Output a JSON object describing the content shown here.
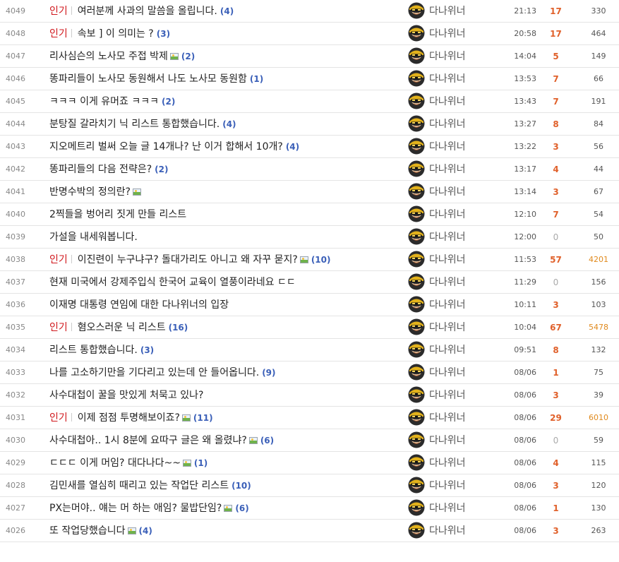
{
  "hot_label": "인기",
  "writer_name": "다나위너",
  "rows": [
    {
      "num": "4049",
      "hot": true,
      "title": "여러분께 사과의 말씀을 올립니다.",
      "img": false,
      "comments": "(4)",
      "date": "21:13",
      "rec": "17",
      "views": "330"
    },
    {
      "num": "4048",
      "hot": true,
      "title": "속보 ] 이 의미는 ?",
      "img": false,
      "comments": "(3)",
      "date": "20:58",
      "rec": "17",
      "views": "464"
    },
    {
      "num": "4047",
      "hot": false,
      "title": "리사심슨의 노사모 주접 박제",
      "img": true,
      "comments": "(2)",
      "date": "14:04",
      "rec": "5",
      "views": "149"
    },
    {
      "num": "4046",
      "hot": false,
      "title": "똥파리들이 노사모 동원해서 나도 노사모 동원함",
      "img": false,
      "comments": "(1)",
      "date": "13:53",
      "rec": "7",
      "views": "66"
    },
    {
      "num": "4045",
      "hot": false,
      "title": "ㅋㅋㅋ 이게 유머죠 ㅋㅋㅋ",
      "img": false,
      "comments": "(2)",
      "date": "13:43",
      "rec": "7",
      "views": "191"
    },
    {
      "num": "4044",
      "hot": false,
      "title": "분탕질 갈라치기 닉 리스트 통합했습니다.",
      "img": false,
      "comments": "(4)",
      "date": "13:27",
      "rec": "8",
      "views": "84"
    },
    {
      "num": "4043",
      "hot": false,
      "title": "지오메트리 벌써 오늘 글 14개나? 난 이거 합해서 10개?",
      "img": false,
      "comments": "(4)",
      "date": "13:22",
      "rec": "3",
      "views": "56"
    },
    {
      "num": "4042",
      "hot": false,
      "title": "똥파리들의 다음 전략은?",
      "img": false,
      "comments": "(2)",
      "date": "13:17",
      "rec": "4",
      "views": "44"
    },
    {
      "num": "4041",
      "hot": false,
      "title": "반명수박의 정의란?",
      "img": true,
      "comments": "",
      "date": "13:14",
      "rec": "3",
      "views": "67"
    },
    {
      "num": "4040",
      "hot": false,
      "title": "2찍들을 벙어리 짓게 만들 리스트",
      "img": false,
      "comments": "",
      "date": "12:10",
      "rec": "7",
      "views": "54"
    },
    {
      "num": "4039",
      "hot": false,
      "title": "가설을 내세워봅니다.",
      "img": false,
      "comments": "",
      "date": "12:00",
      "rec": "0",
      "views": "50"
    },
    {
      "num": "4038",
      "hot": true,
      "title": "이진련이 누구냐구? 돌대가리도 아니고 왜 자꾸 묻지?",
      "img": true,
      "comments": "(10)",
      "date": "11:53",
      "rec": "57",
      "views": "4201"
    },
    {
      "num": "4037",
      "hot": false,
      "title": "현재 미국에서 강제주입식 한국어 교육이 열풍이라네요 ㄷㄷ",
      "img": false,
      "comments": "",
      "date": "11:29",
      "rec": "0",
      "views": "156"
    },
    {
      "num": "4036",
      "hot": false,
      "title": "이재명 대통령 연임에 대한 다나위너의 입장",
      "img": false,
      "comments": "",
      "date": "10:11",
      "rec": "3",
      "views": "103"
    },
    {
      "num": "4035",
      "hot": true,
      "title": "혐오스러운 닉 리스트",
      "img": false,
      "comments": "(16)",
      "date": "10:04",
      "rec": "67",
      "views": "5478"
    },
    {
      "num": "4034",
      "hot": false,
      "title": "리스트 통합했습니다.",
      "img": false,
      "comments": "(3)",
      "date": "09:51",
      "rec": "8",
      "views": "132"
    },
    {
      "num": "4033",
      "hot": false,
      "title": "나를 고소하기만을 기다리고 있는데 안 들어옵니다.",
      "img": false,
      "comments": "(9)",
      "date": "08/06",
      "rec": "1",
      "views": "75"
    },
    {
      "num": "4032",
      "hot": false,
      "title": "사수대첩이 꿀을 맛있게 처묵고 있나?",
      "img": false,
      "comments": "",
      "date": "08/06",
      "rec": "3",
      "views": "39"
    },
    {
      "num": "4031",
      "hot": true,
      "title": "이제 점점 투명해보이죠?",
      "img": true,
      "comments": "(11)",
      "date": "08/06",
      "rec": "29",
      "views": "6010"
    },
    {
      "num": "4030",
      "hot": false,
      "title": "사수대첩아.. 1시 8분에 요따구 글은 왜 올렸냐?",
      "img": true,
      "comments": "(6)",
      "date": "08/06",
      "rec": "0",
      "views": "59"
    },
    {
      "num": "4029",
      "hot": false,
      "title": "ㄷㄷㄷ 이게 머임? 대다나다~~",
      "img": true,
      "comments": "(1)",
      "date": "08/06",
      "rec": "4",
      "views": "115"
    },
    {
      "num": "4028",
      "hot": false,
      "title": "김민새를 열심히 때리고 있는 작업단 리스트",
      "img": false,
      "comments": "(10)",
      "date": "08/06",
      "rec": "3",
      "views": "120"
    },
    {
      "num": "4027",
      "hot": false,
      "title": "PX는머야.. 얘는 머 하는 애임? 물밥단임?",
      "img": true,
      "comments": "(6)",
      "date": "08/06",
      "rec": "1",
      "views": "130"
    },
    {
      "num": "4026",
      "hot": false,
      "title": "또 작업당했습니다",
      "img": true,
      "comments": "(4)",
      "date": "08/06",
      "rec": "3",
      "views": "263"
    }
  ]
}
